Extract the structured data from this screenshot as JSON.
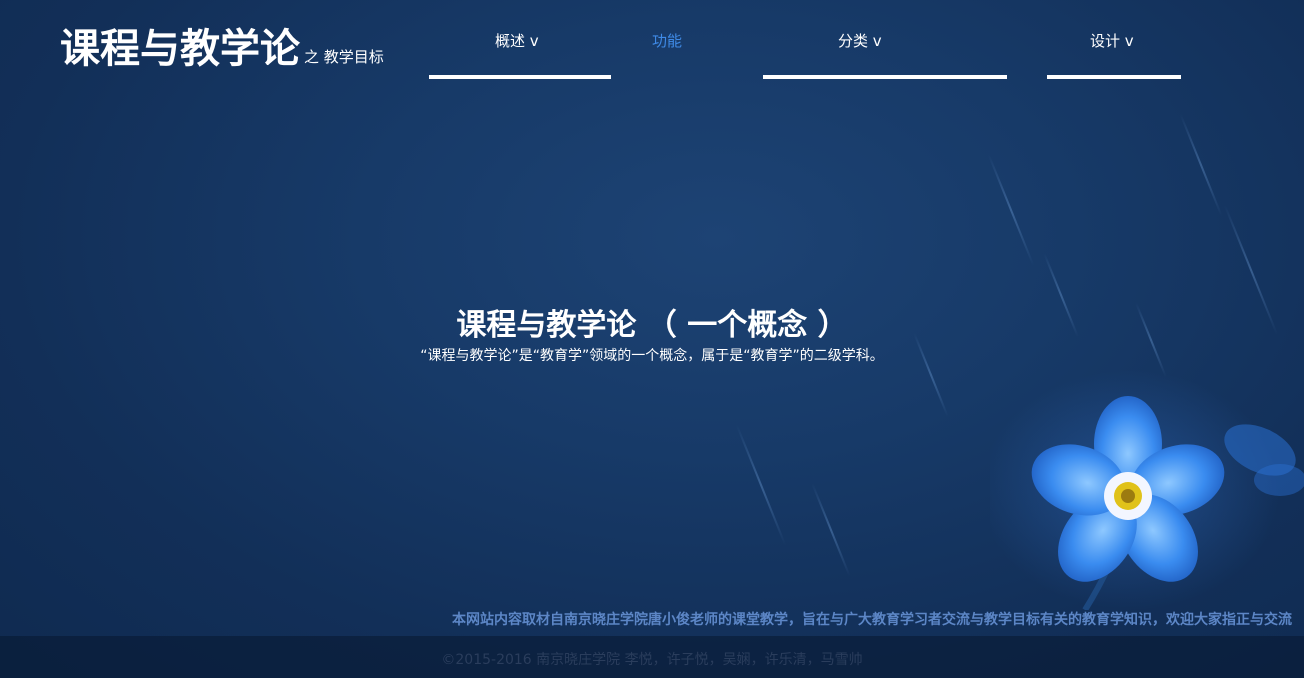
{
  "header": {
    "title": "课程与教学论",
    "subtitle": "之 教学目标"
  },
  "nav": {
    "items": [
      {
        "label": "概述 v"
      },
      {
        "label": "功能"
      },
      {
        "label": "分类 v"
      },
      {
        "label": "设计 v"
      }
    ],
    "active_color": "#3f8ae6"
  },
  "hero": {
    "title": "课程与教学论 （ 一个概念 ）",
    "description": "“课程与教学论”是“教育学”领域的一个概念，属于是“教育学”的二级学科。"
  },
  "footer": {
    "notice": "本网站内容取材自南京晓庄学院唐小俊老师的课堂教学，旨在与广大教育学习者交流与教学目标有关的教育学知识，欢迎大家指正与交流",
    "copyright": "©2015-2016 南京晓庄学院 李悦，许子悦，吴娴，许乐清，马雪帅"
  },
  "colors": {
    "background": "#173a68",
    "flower": "#2f7be0"
  }
}
